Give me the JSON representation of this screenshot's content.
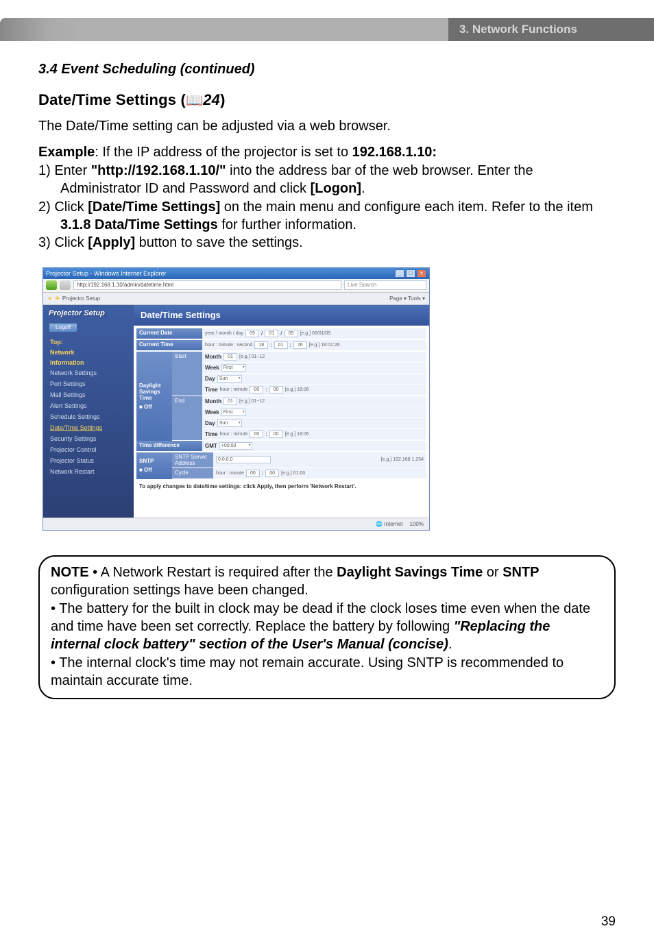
{
  "header": {
    "label": "3. Network Functions"
  },
  "section": {
    "title": "3.4 Event Scheduling (continued)"
  },
  "subsection": {
    "title_prefix": "Date/Time Settings (",
    "ref": "24",
    "title_suffix": ")"
  },
  "intro": "The Date/Time setting can be adjusted via a web browser.",
  "example": {
    "label": "Example",
    "text": ": If the IP address of the projector is set to ",
    "ip": "192.168.1.10:"
  },
  "steps": {
    "s1a": "1) Enter ",
    "s1url": "\"http://192.168.1.10/\"",
    "s1b": " into the address bar of the web browser. Enter the Administrator ID and Password and click ",
    "s1btn": "[Logon]",
    "s1c": ".",
    "s2a": "2) Click ",
    "s2btn": "[Date/Time Settings]",
    "s2b": " on the main menu and configure each item. Refer to the item ",
    "s2ref": "3.1.8 Data/Time Settings",
    "s2c": " for further information.",
    "s3a": "3) Click ",
    "s3btn": "[Apply]",
    "s3b": " button to save the settings."
  },
  "screenshot": {
    "title": "Projector Setup - Windows Internet Explorer",
    "url": "http://192.168.1.10/admin/datetime.html",
    "search_ph": "Live Search",
    "tab": "Projector Setup",
    "toolbar": "Page ▾   Tools ▾",
    "logo": "Projector Setup",
    "logoff": "Logoff",
    "menu_top_a": "Top:",
    "menu_top_b": "Network",
    "menu_top_c": "Information",
    "menu": [
      "Network Settings",
      "Port Settings",
      "Mail Settings",
      "Alert Settings",
      "Schedule Settings",
      "Date/Time Settings",
      "Security Settings",
      "Projector Control",
      "Projector Status",
      "Network Restart"
    ],
    "main_header": "Date/Time Settings",
    "rows": {
      "curdate": "Current Date",
      "curdate_hint": "year / month / day",
      "curdate_eg": "[e.g.] 06/01/05",
      "curtime": "Current Time",
      "curtime_hint": "hour : minute : second",
      "curtime_eg": "[e.g.] 18:01:26",
      "dst": "Daylight Savings Time",
      "off": "■ Off",
      "start": "Start",
      "end": "End",
      "month": "Month",
      "month_eg": "[e.g.] 01~12",
      "week": "Week",
      "week_val": "First",
      "day": "Day",
      "day_val": "Sun",
      "time": "Time",
      "time_hint": "hour : minute",
      "time_eg": "[e.g.] 18:06",
      "timediff": "Time difference",
      "gmt": "GMT",
      "gmt_val": "+00:00",
      "sntp": "SNTP",
      "sntp_srv": "SNTP Server Address",
      "sntp_val": "0.0.0.0",
      "sntp_eg": "[e.g.] 192.168.1.254",
      "cycle": "Cycle",
      "cycle_hint": "hour : minute",
      "cycle_eg": "[e.g.] 01:00",
      "apply_note": "To apply changes to date/time settings: click Apply, then perform 'Network Restart'."
    },
    "status": {
      "internet": "Internet",
      "zoom": "100%"
    }
  },
  "note": {
    "label": "NOTE",
    "l1a": "  • A Network Restart is required after the ",
    "l1b": "Daylight Savings Time",
    "l1c": " or ",
    "l2a": "SNTP",
    "l2b": " configuration settings have been changed.",
    "l3": "• The battery for the built in clock may be dead if the clock loses time even when the date and time have been set correctly. Replace the battery by following ",
    "l3b": "\"Replacing the internal clock battery\" section of the User's Manual (concise)",
    "l3c": ".",
    "l4": "• The internal clock's time may not remain accurate. Using SNTP is recommended to maintain accurate time."
  },
  "page_number": "39",
  "vals": {
    "y": "09",
    "mo": "01",
    "d": "05",
    "h": "18",
    "mi": "01",
    "s": "26",
    "m1": "01",
    "m2": "01",
    "th": "00",
    "tm": "00",
    "ch": "00",
    "cm": "00"
  }
}
